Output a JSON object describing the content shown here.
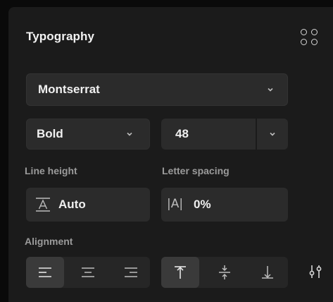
{
  "panel": {
    "title": "Typography"
  },
  "font": {
    "family": "Montserrat",
    "weight": "Bold",
    "size": "48"
  },
  "line_height": {
    "label": "Line height",
    "value": "Auto"
  },
  "letter_spacing": {
    "label": "Letter spacing",
    "value": "0%"
  },
  "alignment": {
    "label": "Alignment",
    "horizontal_selected": "left",
    "vertical_selected": "top"
  },
  "icons": [
    "grid-icon",
    "chevron-down-icon",
    "line-height-icon",
    "letter-spacing-icon",
    "align-left-icon",
    "align-center-icon",
    "align-right-icon",
    "align-top-icon",
    "align-middle-icon",
    "align-bottom-icon",
    "tune-icon"
  ],
  "colors": {
    "background": "#1b1b1b",
    "field": "#2b2b2b",
    "text": "#f0f0f0",
    "muted": "#9b9b9b"
  }
}
